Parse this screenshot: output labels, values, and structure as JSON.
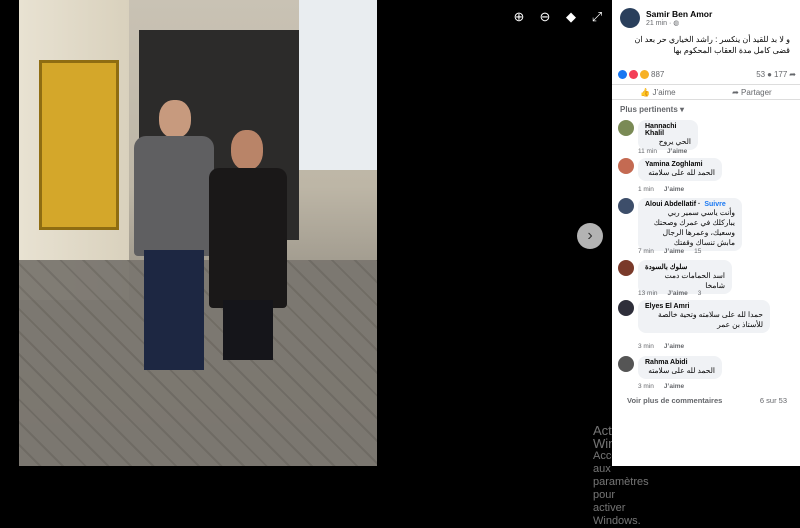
{
  "viewer": {
    "zoom_in_icon": "zoom-in-icon",
    "zoom_out_icon": "zoom-out-icon",
    "tag_icon": "tag-icon",
    "fullscreen_icon": "fullscreen-icon",
    "next_icon": "chevron-right-icon"
  },
  "watermark": {
    "line1": "Activer Windows",
    "line2": "Accédez aux paramètres pour activer Windows."
  },
  "post": {
    "author": "Samir Ben Amor",
    "time": "21 min · ",
    "text": "و لا بد للقيد أن ينكسر : راشد الخياري حر بعد ان قضى كامل مدة العقاب المحكوم بها",
    "reactions_count": "887",
    "comments_count": "53",
    "shares_count": "177",
    "like_label": "J’aime",
    "share_label": "Partager"
  },
  "comments_header": "Plus pertinents",
  "comments": [
    {
      "name": "Hannachi Khalil",
      "text": "الحي يروح",
      "time": "11 min",
      "like": "J’aime",
      "color": "#7a8a55"
    },
    {
      "name": "Yamina Zoghlami",
      "text": "الحمد لله على سلامته",
      "time": "1 min",
      "like": "J’aime",
      "color": "#c46a52"
    },
    {
      "name": "Aloui Abdellatif",
      "follow": "Suivre",
      "text": "وأنت ياسي سمير ربي يباركلك في عمرك وصحتك وسعيك، وعمرها الرجال مابش تنساك وقفتك",
      "time": "7 min",
      "like": "J’aime",
      "count": "15",
      "color": "#3d4e6a"
    },
    {
      "name": "سلوك بالسودة",
      "text": "اسد الحمامات دمت شامخا",
      "time": "13 min",
      "like": "J’aime",
      "count": "3",
      "color": "#7a3a2a"
    },
    {
      "name": "Elyes El Amri",
      "text": "حمدا لله على سلامته وتحية خالصة للأستاذ بن عمر",
      "time": "3 min",
      "like": "J’aime",
      "color": "#2e2e3a"
    },
    {
      "name": "Rahma Abidi",
      "text": "الحمد لله على سلامته",
      "time": "3 min",
      "like": "J’aime",
      "color": "#555"
    }
  ],
  "footer": {
    "more_label": "Voir plus de commentaires",
    "page_info": "6 sur 53"
  }
}
